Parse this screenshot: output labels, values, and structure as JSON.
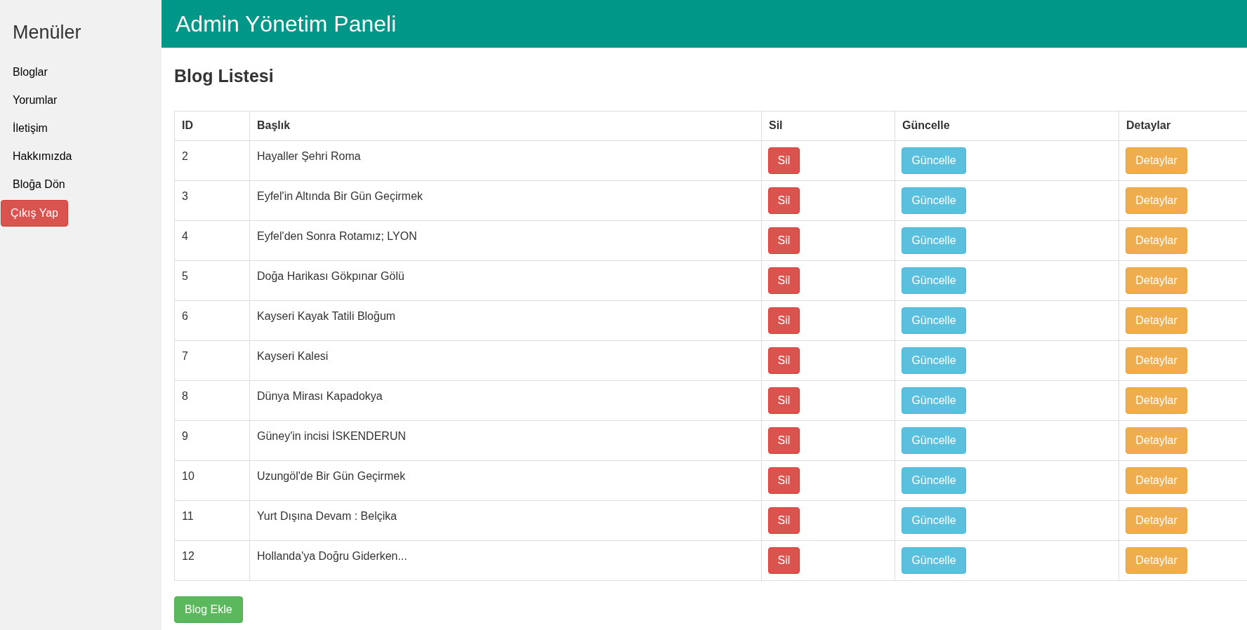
{
  "sidebar": {
    "title": "Menüler",
    "items": [
      "Bloglar",
      "Yorumlar",
      "İletişim",
      "Hakkımızda",
      "Bloğa Dön"
    ],
    "logout": "Çıkış Yap"
  },
  "header": {
    "title": "Admin Yönetim Paneli"
  },
  "page_title": "Blog Listesi",
  "table": {
    "columns": [
      "ID",
      "Başlık",
      "Sil",
      "Güncelle",
      "Detaylar"
    ],
    "rows": [
      {
        "id": "2",
        "title": "Hayaller Şehri Roma",
        "delete": "Sil",
        "update": "Güncelle",
        "details": "Detaylar"
      },
      {
        "id": "3",
        "title": "Eyfel'in Altında Bir Gün Geçirmek",
        "delete": "Sil",
        "update": "Güncelle",
        "details": "Detaylar"
      },
      {
        "id": "4",
        "title": "Eyfel'den Sonra Rotamız; LYON",
        "delete": "Sil",
        "update": "Güncelle",
        "details": "Detaylar"
      },
      {
        "id": "5",
        "title": "Doğa Harikası Gökpınar Gölü",
        "delete": "Sil",
        "update": "Güncelle",
        "details": "Detaylar"
      },
      {
        "id": "6",
        "title": "Kayseri Kayak Tatili Bloğum",
        "delete": "Sil",
        "update": "Güncelle",
        "details": "Detaylar"
      },
      {
        "id": "7",
        "title": "Kayseri Kalesi",
        "delete": "Sil",
        "update": "Güncelle",
        "details": "Detaylar"
      },
      {
        "id": "8",
        "title": "Dünya Mirası Kapadokya",
        "delete": "Sil",
        "update": "Güncelle",
        "details": "Detaylar"
      },
      {
        "id": "9",
        "title": "Güney'in incisi İSKENDERUN",
        "delete": "Sil",
        "update": "Güncelle",
        "details": "Detaylar"
      },
      {
        "id": "10",
        "title": "Uzungöl'de Bir Gün Geçirmek",
        "delete": "Sil",
        "update": "Güncelle",
        "details": "Detaylar"
      },
      {
        "id": "11",
        "title": "Yurt Dışına Devam : Belçika",
        "delete": "Sil",
        "update": "Güncelle",
        "details": "Detaylar"
      },
      {
        "id": "12",
        "title": "Hollanda'ya Doğru Giderken...",
        "delete": "Sil",
        "update": "Güncelle",
        "details": "Detaylar"
      }
    ]
  },
  "add_button": "Blog Ekle"
}
